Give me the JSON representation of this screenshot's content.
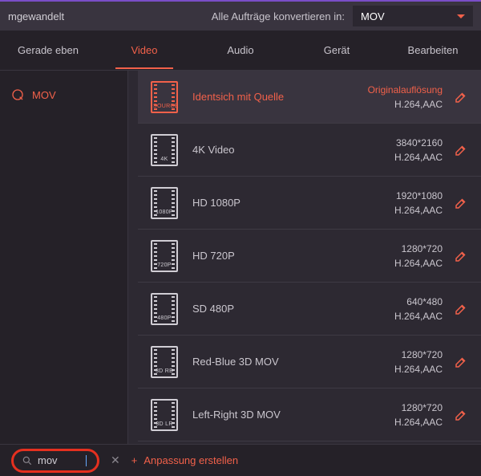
{
  "topbar": {
    "left_text": "mgewandelt",
    "convert_label": "Alle Aufträge konvertieren in:",
    "convert_value": "MOV"
  },
  "tabs": [
    "Gerade eben",
    "Video",
    "Audio",
    "Gerät",
    "Bearbeiten"
  ],
  "active_tab": "Video",
  "sidebar": {
    "items": [
      {
        "label": "MOV"
      }
    ]
  },
  "presets": [
    {
      "tag": "SOURCE",
      "name": "Identsich mit Quelle",
      "res": "Originalauflösung",
      "codec": "H.264,AAC",
      "selected": true
    },
    {
      "tag": "4K",
      "name": "4K Video",
      "res": "3840*2160",
      "codec": "H.264,AAC"
    },
    {
      "tag": "1080P",
      "name": "HD 1080P",
      "res": "1920*1080",
      "codec": "H.264,AAC"
    },
    {
      "tag": "720P",
      "name": "HD 720P",
      "res": "1280*720",
      "codec": "H.264,AAC"
    },
    {
      "tag": "480P",
      "name": "SD 480P",
      "res": "640*480",
      "codec": "H.264,AAC"
    },
    {
      "tag": "3D RB",
      "name": "Red-Blue 3D MOV",
      "res": "1280*720",
      "codec": "H.264,AAC"
    },
    {
      "tag": "3D LR",
      "name": "Left-Right 3D MOV",
      "res": "1280*720",
      "codec": "H.264,AAC"
    }
  ],
  "bottom": {
    "search_value": "mov",
    "add_label": "Anpassung erstellen"
  }
}
